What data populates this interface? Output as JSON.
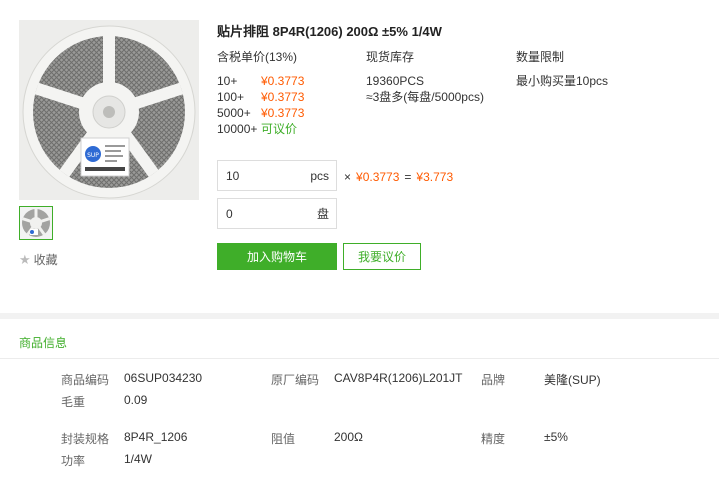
{
  "product": {
    "title": "贴片排阻 8P4R(1206) 200Ω ±5% 1/4W",
    "favorite_label": "收藏",
    "reel_sticker_brand": "SUP"
  },
  "pricing": {
    "header": "含税单价(13%)",
    "tiers": [
      {
        "qty": "10+",
        "price": "¥0.3773"
      },
      {
        "qty": "100+",
        "price": "¥0.3773"
      },
      {
        "qty": "5000+",
        "price": "¥0.3773"
      },
      {
        "qty": "10000+",
        "price": "可议价"
      }
    ]
  },
  "stock": {
    "header": "现货库存",
    "count": "19360PCS",
    "reels": "≈3盘多(每盘/5000pcs)"
  },
  "limit": {
    "header": "数量限制",
    "value": "最小购买量10pcs"
  },
  "order": {
    "pcs_value": "10",
    "pcs_unit": "pcs",
    "reel_value": "0",
    "reel_unit": "盘",
    "times": "×",
    "unit_price": "¥0.3773",
    "equals": "=",
    "total": "¥3.773"
  },
  "buttons": {
    "add_to_cart": "加入购物车",
    "request_quote": "我要议价"
  },
  "info": {
    "section_title": "商品信息",
    "rows": [
      [
        {
          "label": "商品编码",
          "value": "06SUP034230"
        },
        {
          "label": "原厂编码",
          "value": "CAV8P4R(1206)L201JT"
        },
        {
          "label": "品牌",
          "value": "美隆(SUP)"
        }
      ],
      [
        {
          "label": "毛重",
          "value": "0.09"
        }
      ],
      [
        {
          "label": "封装规格",
          "value": "8P4R_1206"
        },
        {
          "label": "阻值",
          "value": "200Ω"
        },
        {
          "label": "精度",
          "value": "±5%"
        }
      ],
      [
        {
          "label": "功率",
          "value": "1/4W"
        }
      ]
    ]
  },
  "colors": {
    "accent_green": "#3fae29",
    "price_orange": "#ff5a00"
  }
}
